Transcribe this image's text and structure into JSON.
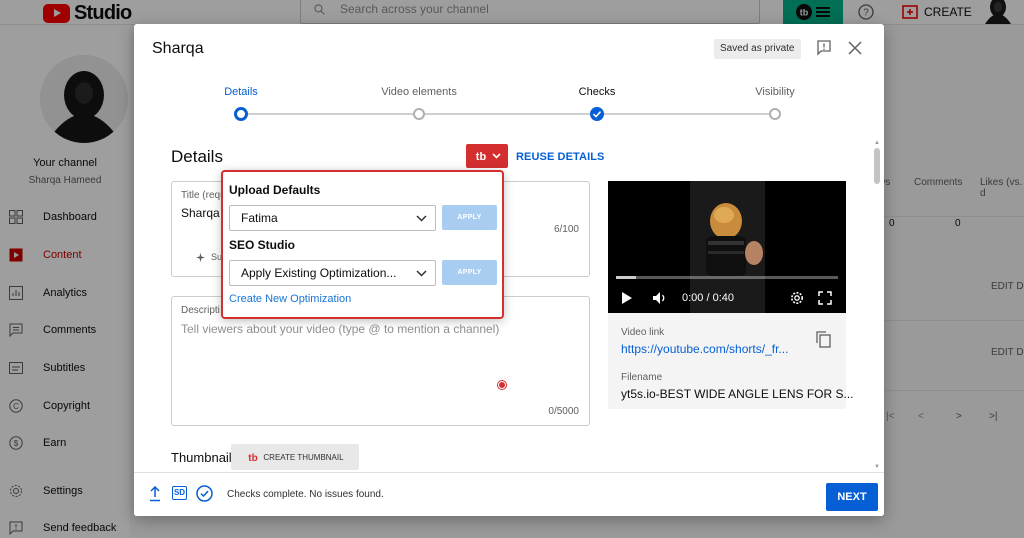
{
  "background": {
    "logo_text": "Studio",
    "search_placeholder": "Search across your channel",
    "create_label": "CREATE",
    "sidebar": {
      "channel_title": "Your channel",
      "channel_name": "Sharqa Hameed",
      "items": [
        {
          "label": "Dashboard",
          "icon": "dashboard-icon"
        },
        {
          "label": "Content",
          "icon": "content-icon",
          "active": true
        },
        {
          "label": "Analytics",
          "icon": "analytics-icon"
        },
        {
          "label": "Comments",
          "icon": "comments-icon"
        },
        {
          "label": "Subtitles",
          "icon": "subtitles-icon"
        },
        {
          "label": "Copyright",
          "icon": "copyright-icon"
        },
        {
          "label": "Earn",
          "icon": "earn-icon"
        },
        {
          "label": "Settings",
          "icon": "settings-icon"
        },
        {
          "label": "Send feedback",
          "icon": "feedback-icon"
        }
      ]
    },
    "table": {
      "headers": [
        "ws",
        "Comments",
        "Likes (vs. d"
      ],
      "row1": {
        "views": "0",
        "comments": "0"
      },
      "edit_1": "EDIT D",
      "edit_2": "EDIT D"
    }
  },
  "dialog": {
    "title": "Sharqa",
    "saved_badge": "Saved as private",
    "steps": [
      {
        "label": "Details",
        "state": "active"
      },
      {
        "label": "Video elements",
        "state": "pending"
      },
      {
        "label": "Checks",
        "state": "done"
      },
      {
        "label": "Visibility",
        "state": "pending"
      }
    ],
    "details_heading": "Details",
    "reuse_details": "REUSE DETAILS",
    "title_field": {
      "label": "Title (requ",
      "value": "Sharqa",
      "count": "6/100",
      "suggest": "Su"
    },
    "description_field": {
      "label": "Descripti",
      "placeholder": "Tell viewers about your video (type @ to mention a channel)",
      "count": "0/5000"
    },
    "thumbnail": {
      "label": "Thumbnail",
      "create_button": "CREATE THUMBNAIL"
    },
    "preview": {
      "time": "0:00 / 0:40",
      "link_label": "Video link",
      "link_value": "https://youtube.com/shorts/_fr...",
      "filename_label": "Filename",
      "filename_value": "yt5s.io-BEST WIDE ANGLE LENS FOR S..."
    },
    "footer": {
      "checks_text": "Checks complete. No issues found.",
      "sd_badge": "SD",
      "next_label": "NEXT"
    }
  },
  "popup": {
    "upload_defaults_heading": "Upload Defaults",
    "upload_defaults_value": "Fatima",
    "seo_heading": "SEO Studio",
    "seo_value": "Apply Existing Optimization...",
    "apply_label": "APPLY",
    "create_link": "Create New Optimization"
  },
  "colors": {
    "accent": "#065fd4",
    "tubebuddy_red": "#d32f2f",
    "tubebuddy_green": "#00b388",
    "youtube_red": "#ff0000"
  }
}
